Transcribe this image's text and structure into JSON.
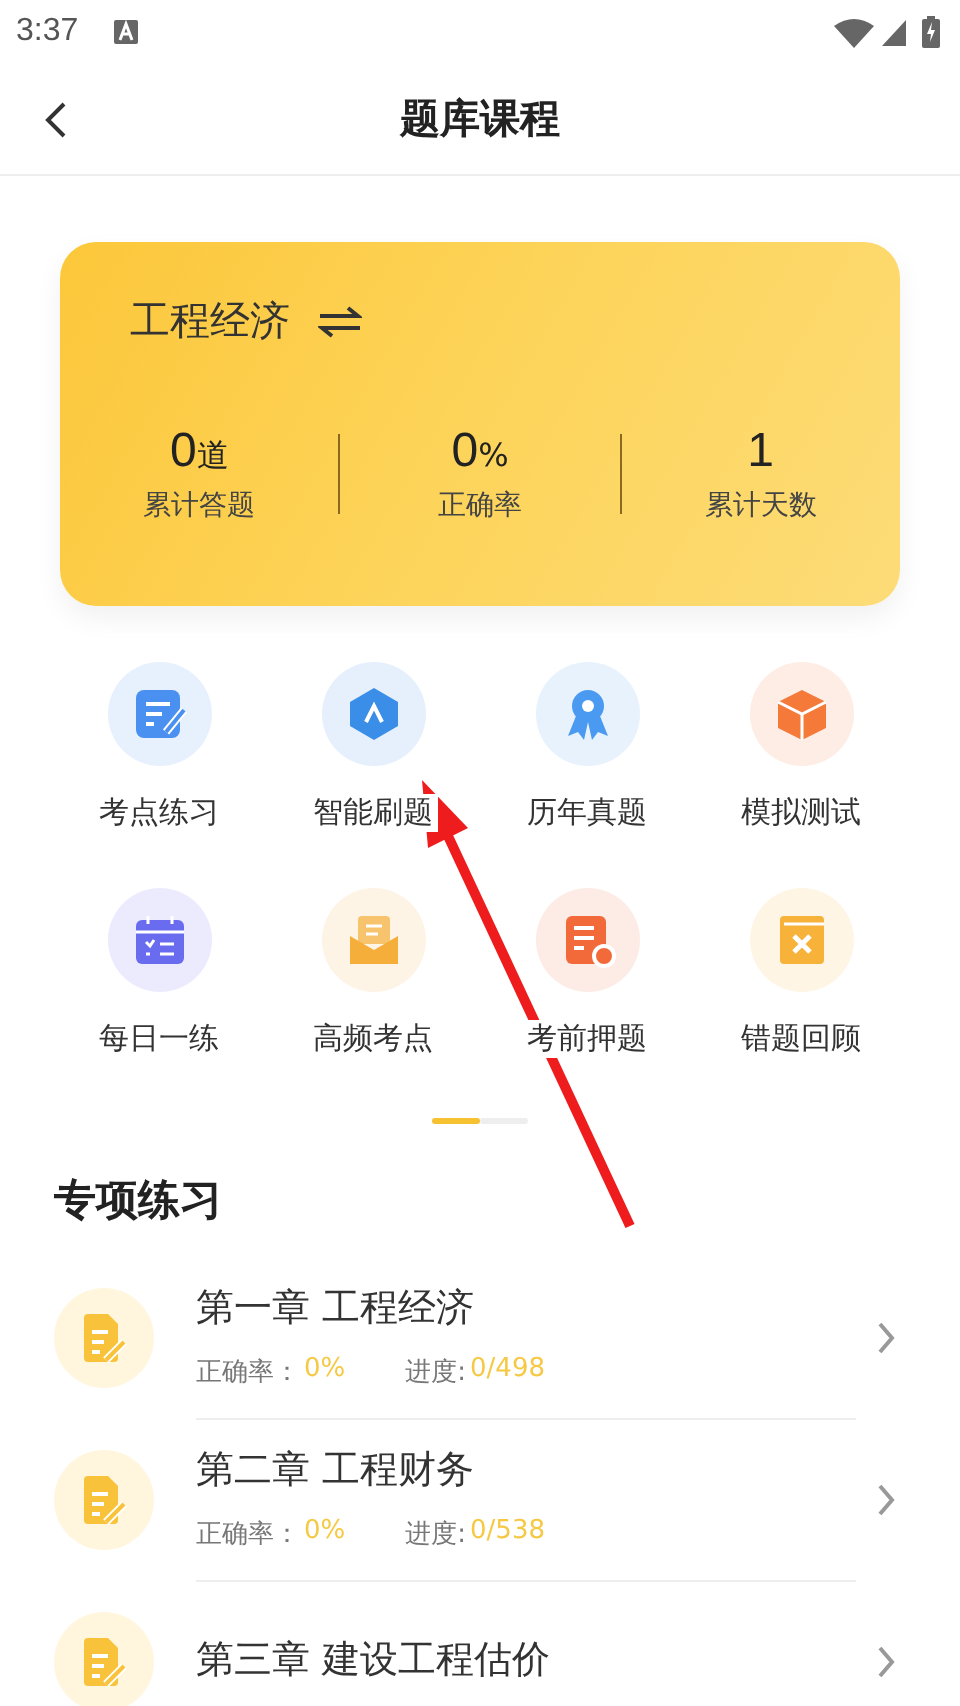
{
  "status_bar": {
    "time": "3:37"
  },
  "header": {
    "title": "题库课程"
  },
  "subject_card": {
    "name": "工程经济",
    "stats": [
      {
        "value": "0",
        "unit": "道",
        "label": "累计答题"
      },
      {
        "value": "0",
        "unit": "%",
        "label": "正确率"
      },
      {
        "value": "1",
        "label": "累计天数"
      }
    ]
  },
  "features": [
    {
      "label": "考点练习",
      "color": "#4a90f0"
    },
    {
      "label": "智能刷题",
      "color": "#3a8ee8"
    },
    {
      "label": "历年真题",
      "color": "#4a9af2"
    },
    {
      "label": "模拟测试",
      "color": "#f57a3a"
    },
    {
      "label": "每日一练",
      "color": "#6a6cf0"
    },
    {
      "label": "高频考点",
      "color": "#f5ae3a"
    },
    {
      "label": "考前押题",
      "color": "#f26a3a"
    },
    {
      "label": "错题回顾",
      "color": "#f7b23a"
    }
  ],
  "pager": [
    {
      "selected": true
    },
    {
      "selected": false
    }
  ],
  "section": {
    "title": "专项练习"
  },
  "chapters": [
    {
      "title": "第一章 工程经济",
      "accuracy_label": "正确率：",
      "accuracy": "0%",
      "progress_label": "进度:",
      "progress": "0/498"
    },
    {
      "title": "第二章 工程财务",
      "accuracy_label": "正确率：",
      "accuracy": "0%",
      "progress_label": "进度:",
      "progress": "0/538"
    },
    {
      "title": "第三章 建设工程估价"
    }
  ]
}
